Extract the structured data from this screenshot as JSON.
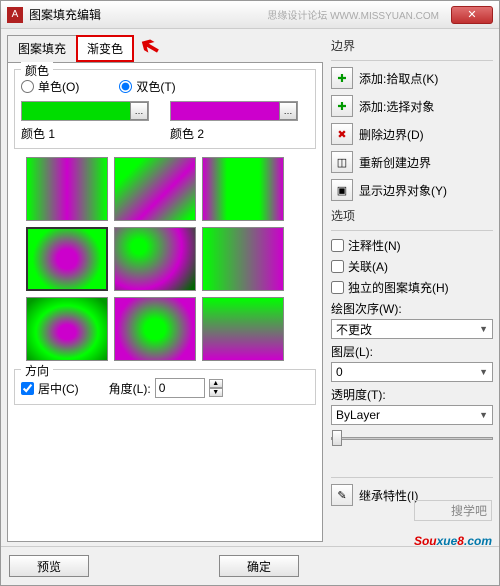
{
  "titlebar": {
    "title": "图案填充编辑",
    "close": "✕"
  },
  "watermark": "思缘设计论坛  WWW.MISSYUAN.COM",
  "tabs": {
    "pattern": "图案填充",
    "gradient": "渐变色"
  },
  "color_group": {
    "title": "颜色",
    "single": "单色(O)",
    "two": "双色(T)",
    "color1_label": "颜色 1",
    "color2_label": "颜色 2",
    "color1": "#00dd00",
    "color2": "#cc00cc"
  },
  "direction_group": {
    "title": "方向",
    "center": "居中(C)",
    "angle_label": "角度(L):",
    "angle_value": "0"
  },
  "boundary": {
    "title": "边界",
    "add_pick": "添加:拾取点(K)",
    "add_select": "添加:选择对象",
    "remove": "删除边界(D)",
    "recreate": "重新创建边界",
    "show": "显示边界对象(Y)"
  },
  "options": {
    "title": "选项",
    "annotative": "注释性(N)",
    "associative": "关联(A)",
    "independent": "独立的图案填充(H)",
    "draw_order_label": "绘图次序(W):",
    "draw_order_value": "不更改",
    "layer_label": "图层(L):",
    "layer_value": "0",
    "transparency_label": "透明度(T):",
    "transparency_value": "ByLayer",
    "inherit": "继承特性(I)"
  },
  "footer": {
    "preview": "预览",
    "ok": "确定"
  },
  "logo": {
    "text1": "搜学吧",
    "brand": "Souxue8",
    "suffix": ".com"
  }
}
